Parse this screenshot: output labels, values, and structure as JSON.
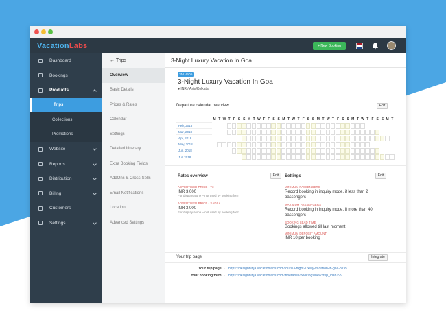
{
  "brand": {
    "part1": "Vacation",
    "part2": "Labs"
  },
  "topbar": {
    "new_booking": "+ New Booking"
  },
  "sidebar": {
    "items": [
      {
        "label": "Dashboard"
      },
      {
        "label": "Bookings"
      },
      {
        "label": "Products"
      },
      {
        "label": "Website"
      },
      {
        "label": "Reports"
      },
      {
        "label": "Distribution"
      },
      {
        "label": "Billing"
      },
      {
        "label": "Customers"
      },
      {
        "label": "Settings"
      }
    ],
    "products_sub": [
      {
        "label": "Trips"
      },
      {
        "label": "Collections"
      },
      {
        "label": "Promotions"
      }
    ]
  },
  "submenu": {
    "back": "← Trips",
    "items": [
      "Overview",
      "Basic Details",
      "Prices & Rates",
      "Calendar",
      "Settings",
      "Detailed Itinerary",
      "Extra Booking Fields",
      "AddOns & Cross-Sells",
      "Email Notifications",
      "Location",
      "Advanced Settings"
    ]
  },
  "main": {
    "header": "3-Night Luxury Vacation In Goa",
    "tag": "3NL-GOA",
    "title": "3-Night Luxury Vacation In Goa",
    "timezone": "INR / Asia/Kolkata",
    "calendar_label": "Departure calendar overview",
    "edit": "Edit",
    "weekdays": [
      "M",
      "T",
      "W",
      "T",
      "F",
      "S",
      "S",
      "M",
      "T",
      "W",
      "T",
      "F",
      "S",
      "S",
      "M",
      "T",
      "W",
      "T",
      "F",
      "S",
      "S",
      "M",
      "T",
      "W",
      "T",
      "F",
      "S",
      "S",
      "M",
      "T",
      "W",
      "T",
      "F",
      "S",
      "S",
      "M",
      "T"
    ],
    "months": [
      "",
      "Feb, 2018",
      "Mar, 2018",
      "Apr, 2018",
      "May, 2018",
      "Jun, 2018",
      "Jul, 2018"
    ],
    "rates_label": "Rates overview",
    "rates": [
      {
        "label": "ADVERTISED PRICE - T3",
        "value": "INR 3,000",
        "note": "For display alone – not used by booking form"
      },
      {
        "label": "ADVERTISED PRICE - SADSA",
        "value": "INR 3,000",
        "note": "For display alone – not used by booking form"
      }
    ],
    "settings_label": "Settings",
    "settings": [
      {
        "label": "MINIMUM PASSENGERS",
        "value": "Record booking in inquiry mode, if less than 2 passengers"
      },
      {
        "label": "MAXIMUM PASSENGERS",
        "value": "Record booking in inquiry mode, if more than 40 passengers"
      },
      {
        "label": "BOOKING LEAD TIME",
        "value": "Bookings allowed till last moment"
      },
      {
        "label": "MINIMUM DEPOSIT AMOUNT",
        "value": "INR 10 per booking"
      }
    ],
    "trip_page_label": "Your trip page",
    "integrate": "Integrate",
    "trip_page": {
      "label": "Your trip page →",
      "url": "https://designninja.vacationlabs.com/tours/3-night-luxury-vacation-in-goa-8199"
    },
    "booking_form": {
      "label": "Your booking form →",
      "url": "https://designninja.vacationlabs.com/itineraries/bookings/new?trip_id=8199"
    }
  },
  "colors": {
    "sidebar": "#2f3e4b",
    "accent": "#3d9de0",
    "green": "#3cb85a",
    "bg_blue": "#4ba6e4"
  }
}
